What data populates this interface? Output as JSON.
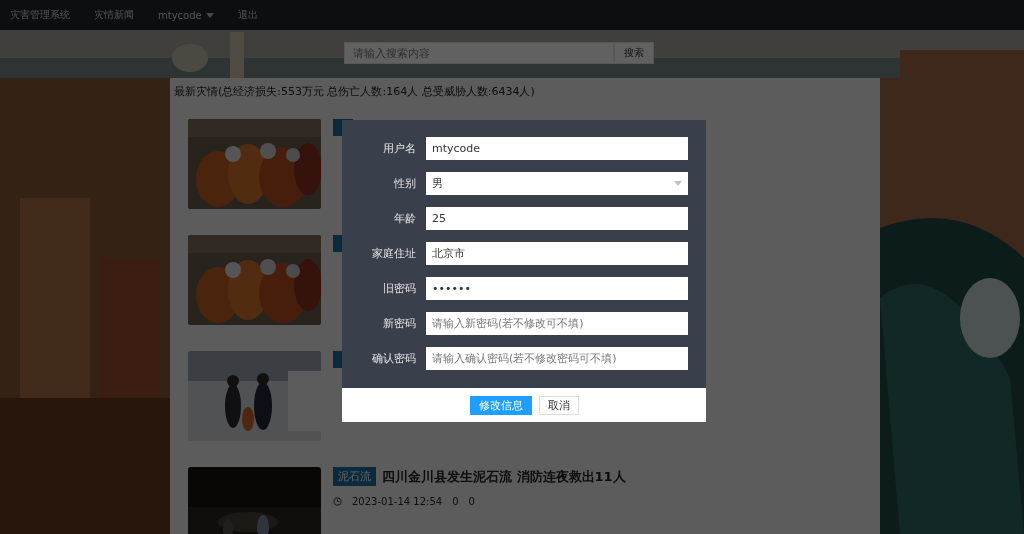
{
  "nav": {
    "brand": "灾害管理系统",
    "links": [
      {
        "label": "灾情新闻",
        "kind": "link"
      },
      {
        "label": "mtycode",
        "kind": "dropdown"
      },
      {
        "label": "退出",
        "kind": "link"
      }
    ]
  },
  "search": {
    "placeholder": "请输入搜索内容",
    "button": "搜索"
  },
  "summary": "最新灾情(总经济损失:553万元 总伤亡人数:164人 总受威胁人数:6434人)",
  "articles": [
    {
      "image": {
        "kind": "picture"
      }
    },
    {
      "image": {
        "kind": "picture"
      }
    },
    {
      "image": {
        "kind": "picture"
      }
    },
    {
      "image": {
        "kind": "picture"
      },
      "tag": "泥石流",
      "title": "四川金川县发生泥石流 消防连夜救出11人",
      "date": "2023-01-14 12:54",
      "views": "0",
      "comments": "0"
    }
  ],
  "dialog": {
    "fields": [
      {
        "label": "用户名",
        "kind": "text",
        "value": "mtycode"
      },
      {
        "label": "性别",
        "kind": "select",
        "value": "男"
      },
      {
        "label": "年龄",
        "kind": "text",
        "value": "25"
      },
      {
        "label": "家庭住址",
        "kind": "text",
        "value": "北京市"
      },
      {
        "label": "旧密码",
        "kind": "text",
        "value": "••••••"
      },
      {
        "label": "新密码",
        "kind": "text",
        "placeholder": "请输入新密码(若不修改可不填)"
      },
      {
        "label": "确认密码",
        "kind": "text",
        "placeholder": "请输入确认密码(若不修改密码可不填)"
      }
    ],
    "buttons": [
      {
        "label": "修改信息",
        "primary": true
      },
      {
        "label": "取消",
        "primary": false
      }
    ]
  }
}
